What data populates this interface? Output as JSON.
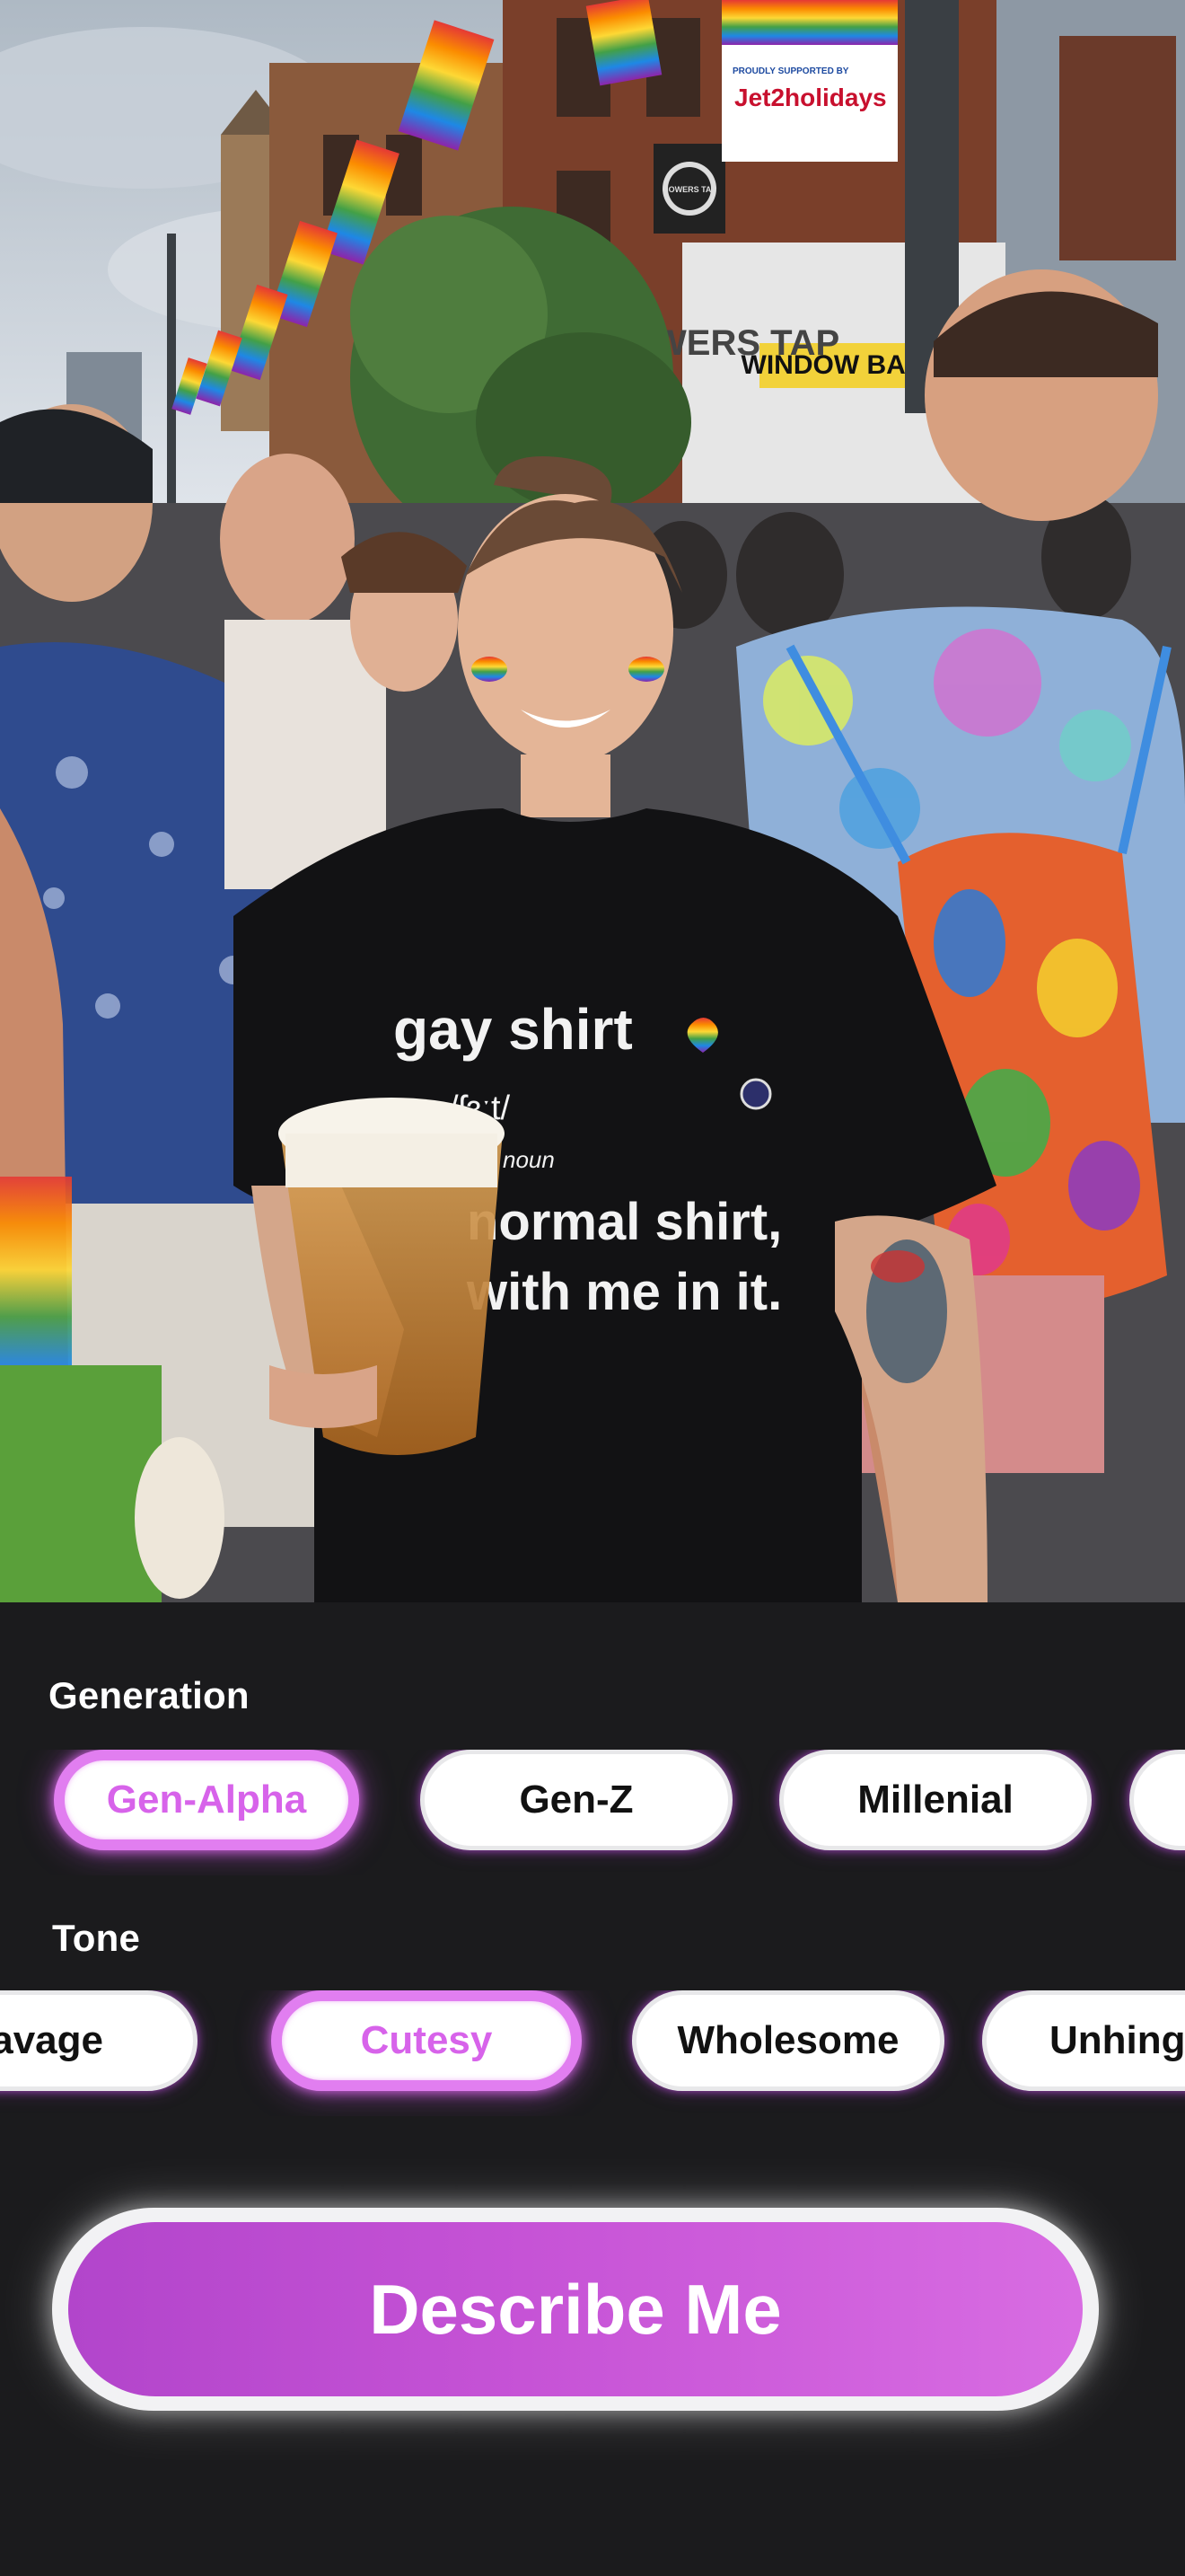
{
  "photo": {
    "shirt_text_line1": "gay shirt",
    "shirt_text_line2": "/ʃɜːt/",
    "shirt_text_line3": "noun",
    "shirt_text_line4": "normal shirt,",
    "shirt_text_line5": "with me in it.",
    "banner_small": "PROUDLY SUPPORTED BY",
    "banner_brand": "Jet2holidays",
    "sign_window_bar": "WINDOW BAR",
    "sign_round": "GOWERS TAP",
    "sign_storefront": "GOWERS TAP"
  },
  "generation": {
    "label": "Generation",
    "options": [
      "Gen-Alpha",
      "Gen-Z",
      "Millenial",
      ""
    ],
    "selected": "Gen-Alpha"
  },
  "tone": {
    "label": "Tone",
    "options": [
      "Savage",
      "Cutesy",
      "Wholesome",
      "Unhinged"
    ],
    "selected": "Cutesy"
  },
  "cta": {
    "label": "Describe Me"
  },
  "colors": {
    "accent": "#d763ea",
    "background": "#1b1b1d",
    "chip_bg": "#ffffff",
    "cta_gradient_start": "#b245cb",
    "cta_gradient_end": "#d86ce2"
  }
}
